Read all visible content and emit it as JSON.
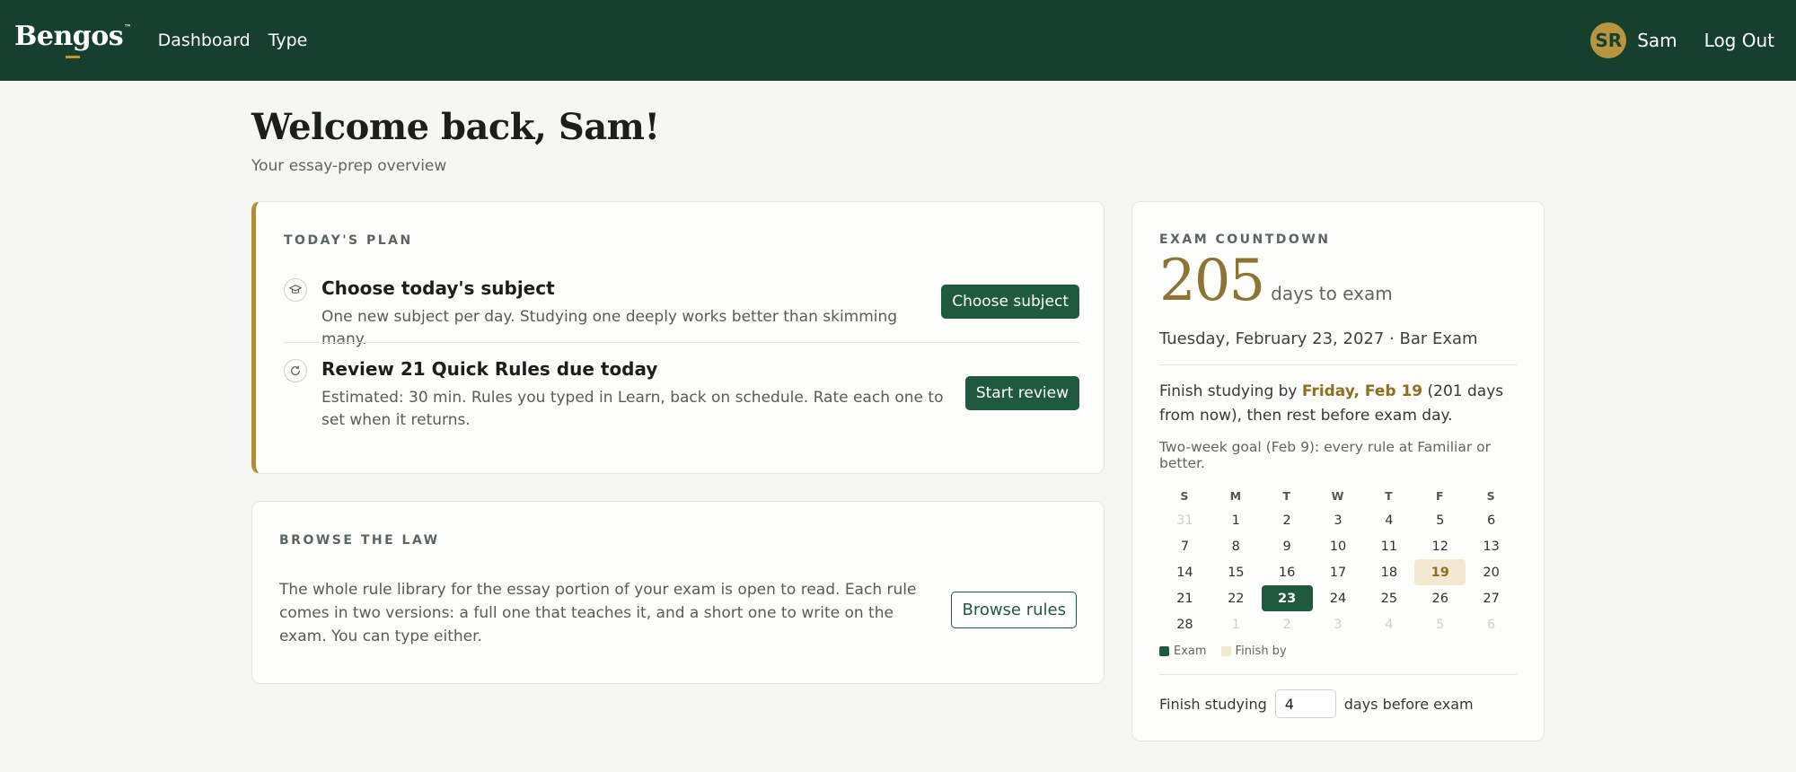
{
  "nav": {
    "brand": "Bengos",
    "brand_mark": "™",
    "links": [
      "Dashboard",
      "Type"
    ],
    "avatar_initials": "SR",
    "user_name": "Sam",
    "logout": "Log Out"
  },
  "header": {
    "title": "Welcome back, Sam!",
    "subtitle": "Your essay-prep overview"
  },
  "plan": {
    "label": "TODAY'S PLAN",
    "items": [
      {
        "icon": "graduation-cap-icon",
        "title": "Choose today's subject",
        "desc": "One new subject per day. Studying one deeply works better than skimming many.",
        "button": "Choose subject"
      },
      {
        "icon": "refresh-icon",
        "title": "Review 21 Quick Rules due today",
        "desc": "Estimated: 30 min. Rules you typed in Learn, back on schedule. Rate each one to set when it returns.",
        "button": "Start review"
      }
    ]
  },
  "browse": {
    "label": "BROWSE THE LAW",
    "desc": "The whole rule library for the essay portion of your exam is open to read. Each rule comes in two versions: a full one that teaches it, and a short one to write on the exam. You can type either.",
    "button": "Browse rules"
  },
  "countdown": {
    "label": "EXAM COUNTDOWN",
    "days": "205",
    "days_unit": "days to exam",
    "exam_date": "Tuesday, February 23, 2027 · Bar Exam",
    "finish_prefix": "Finish studying by ",
    "finish_date": "Friday, Feb 19",
    "finish_suffix": " (201 days from now), then rest before exam day.",
    "goal": "Two-week goal (Feb 9): every rule at Familiar or better.",
    "calendar": {
      "weekdays": [
        "S",
        "M",
        "T",
        "W",
        "T",
        "F",
        "S"
      ],
      "weeks": [
        [
          "31",
          "1",
          "2",
          "3",
          "4",
          "5",
          "6"
        ],
        [
          "7",
          "8",
          "9",
          "10",
          "11",
          "12",
          "13"
        ],
        [
          "14",
          "15",
          "16",
          "17",
          "18",
          "19",
          "20"
        ],
        [
          "21",
          "22",
          "23",
          "24",
          "25",
          "26",
          "27"
        ],
        [
          "28",
          "1",
          "2",
          "3",
          "4",
          "5",
          "6"
        ]
      ],
      "exam_day": "23",
      "finish_day": "19",
      "colors": {
        "exam": "#1f5a3f",
        "finish": "#f3e9d2"
      }
    },
    "legend": {
      "exam": "Exam",
      "finish": "Finish by"
    },
    "setting": {
      "prefix": "Finish studying",
      "value": "4",
      "suffix": "days before exam"
    }
  }
}
